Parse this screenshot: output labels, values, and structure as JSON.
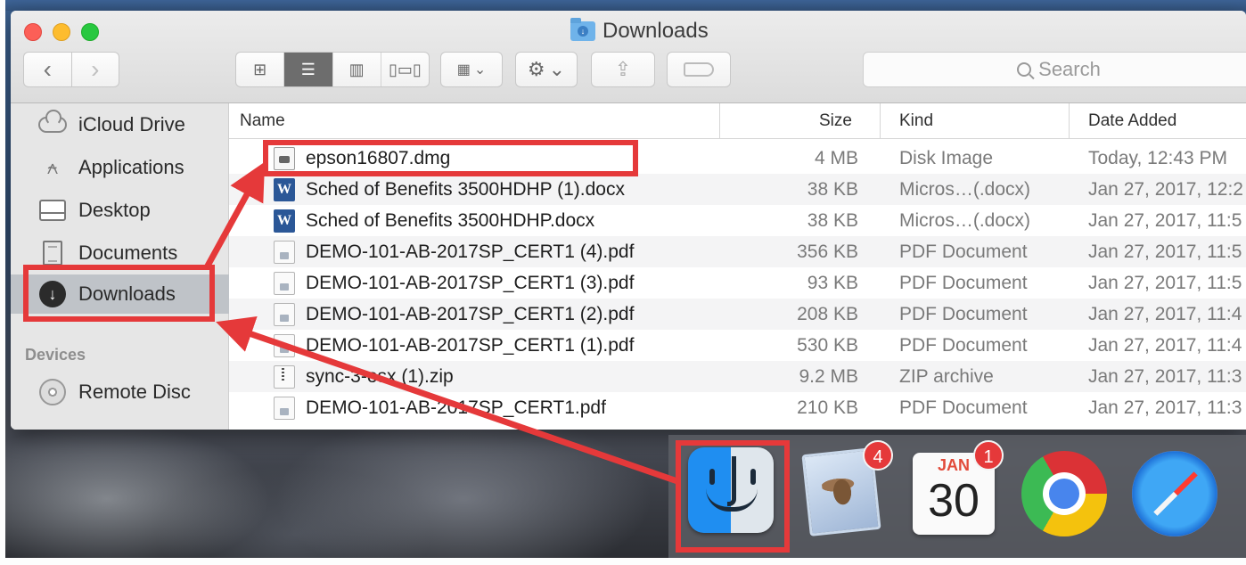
{
  "window": {
    "title": "Downloads"
  },
  "toolbar": {
    "back_icon": "chevron-left",
    "forward_icon": "chevron-right",
    "views": [
      "icon-view",
      "list-view",
      "column-view",
      "cover-flow-view"
    ],
    "active_view": "list-view",
    "arrange_icon": "grid-dropdown",
    "action_icon": "gear-dropdown",
    "share_icon": "share",
    "tag_icon": "tag"
  },
  "search": {
    "placeholder": "Search"
  },
  "sidebar": {
    "favorites": [
      {
        "label": "iCloud Drive",
        "icon": "cloud-icon"
      },
      {
        "label": "Applications",
        "icon": "applications-icon"
      },
      {
        "label": "Desktop",
        "icon": "desktop-icon"
      },
      {
        "label": "Documents",
        "icon": "documents-icon"
      },
      {
        "label": "Downloads",
        "icon": "download-icon",
        "selected": true
      }
    ],
    "devices_heading": "Devices",
    "devices": [
      {
        "label": "Remote Disc",
        "icon": "disc-icon"
      }
    ]
  },
  "columns": {
    "name": "Name",
    "size": "Size",
    "kind": "Kind",
    "date": "Date Added"
  },
  "files": [
    {
      "name": "epson16807.dmg",
      "size": "4 MB",
      "kind": "Disk Image",
      "date": "Today, 12:43 PM",
      "type": "dmg"
    },
    {
      "name": "Sched of Benefits 3500HDHP (1).docx",
      "size": "38 KB",
      "kind": "Micros…(.docx)",
      "date": "Jan 27, 2017, 12:2",
      "type": "docx"
    },
    {
      "name": "Sched of Benefits 3500HDHP.docx",
      "size": "38 KB",
      "kind": "Micros…(.docx)",
      "date": "Jan 27, 2017, 11:5",
      "type": "docx"
    },
    {
      "name": "DEMO-101-AB-2017SP_CERT1 (4).pdf",
      "size": "356 KB",
      "kind": "PDF Document",
      "date": "Jan 27, 2017, 11:5",
      "type": "pdf"
    },
    {
      "name": "DEMO-101-AB-2017SP_CERT1 (3).pdf",
      "size": "93 KB",
      "kind": "PDF Document",
      "date": "Jan 27, 2017, 11:5",
      "type": "pdf"
    },
    {
      "name": "DEMO-101-AB-2017SP_CERT1 (2).pdf",
      "size": "208 KB",
      "kind": "PDF Document",
      "date": "Jan 27, 2017, 11:4",
      "type": "pdf"
    },
    {
      "name": "DEMO-101-AB-2017SP_CERT1 (1).pdf",
      "size": "530 KB",
      "kind": "PDF Document",
      "date": "Jan 27, 2017, 11:4",
      "type": "pdf"
    },
    {
      "name": "sync-3-osx (1).zip",
      "size": "9.2 MB",
      "kind": "ZIP archive",
      "date": "Jan 27, 2017, 11:3",
      "type": "zip"
    },
    {
      "name": "DEMO-101-AB-2017SP_CERT1.pdf",
      "size": "210 KB",
      "kind": "PDF Document",
      "date": "Jan 27, 2017, 11:3",
      "type": "pdf"
    }
  ],
  "dock": {
    "apps": [
      {
        "name": "Finder",
        "icon": "finder-icon",
        "highlighted": true
      },
      {
        "name": "Mail",
        "icon": "mail-icon",
        "badge": "4"
      },
      {
        "name": "Calendar",
        "icon": "calendar-icon",
        "badge": "1",
        "month": "JAN",
        "day": "30"
      },
      {
        "name": "Chrome",
        "icon": "chrome-icon"
      },
      {
        "name": "Safari",
        "icon": "safari-icon"
      }
    ]
  },
  "colors": {
    "annotation_red": "#e5393a",
    "sidebar_selected": "#bfc3c8",
    "finder_blue": "#1f8ef1"
  }
}
